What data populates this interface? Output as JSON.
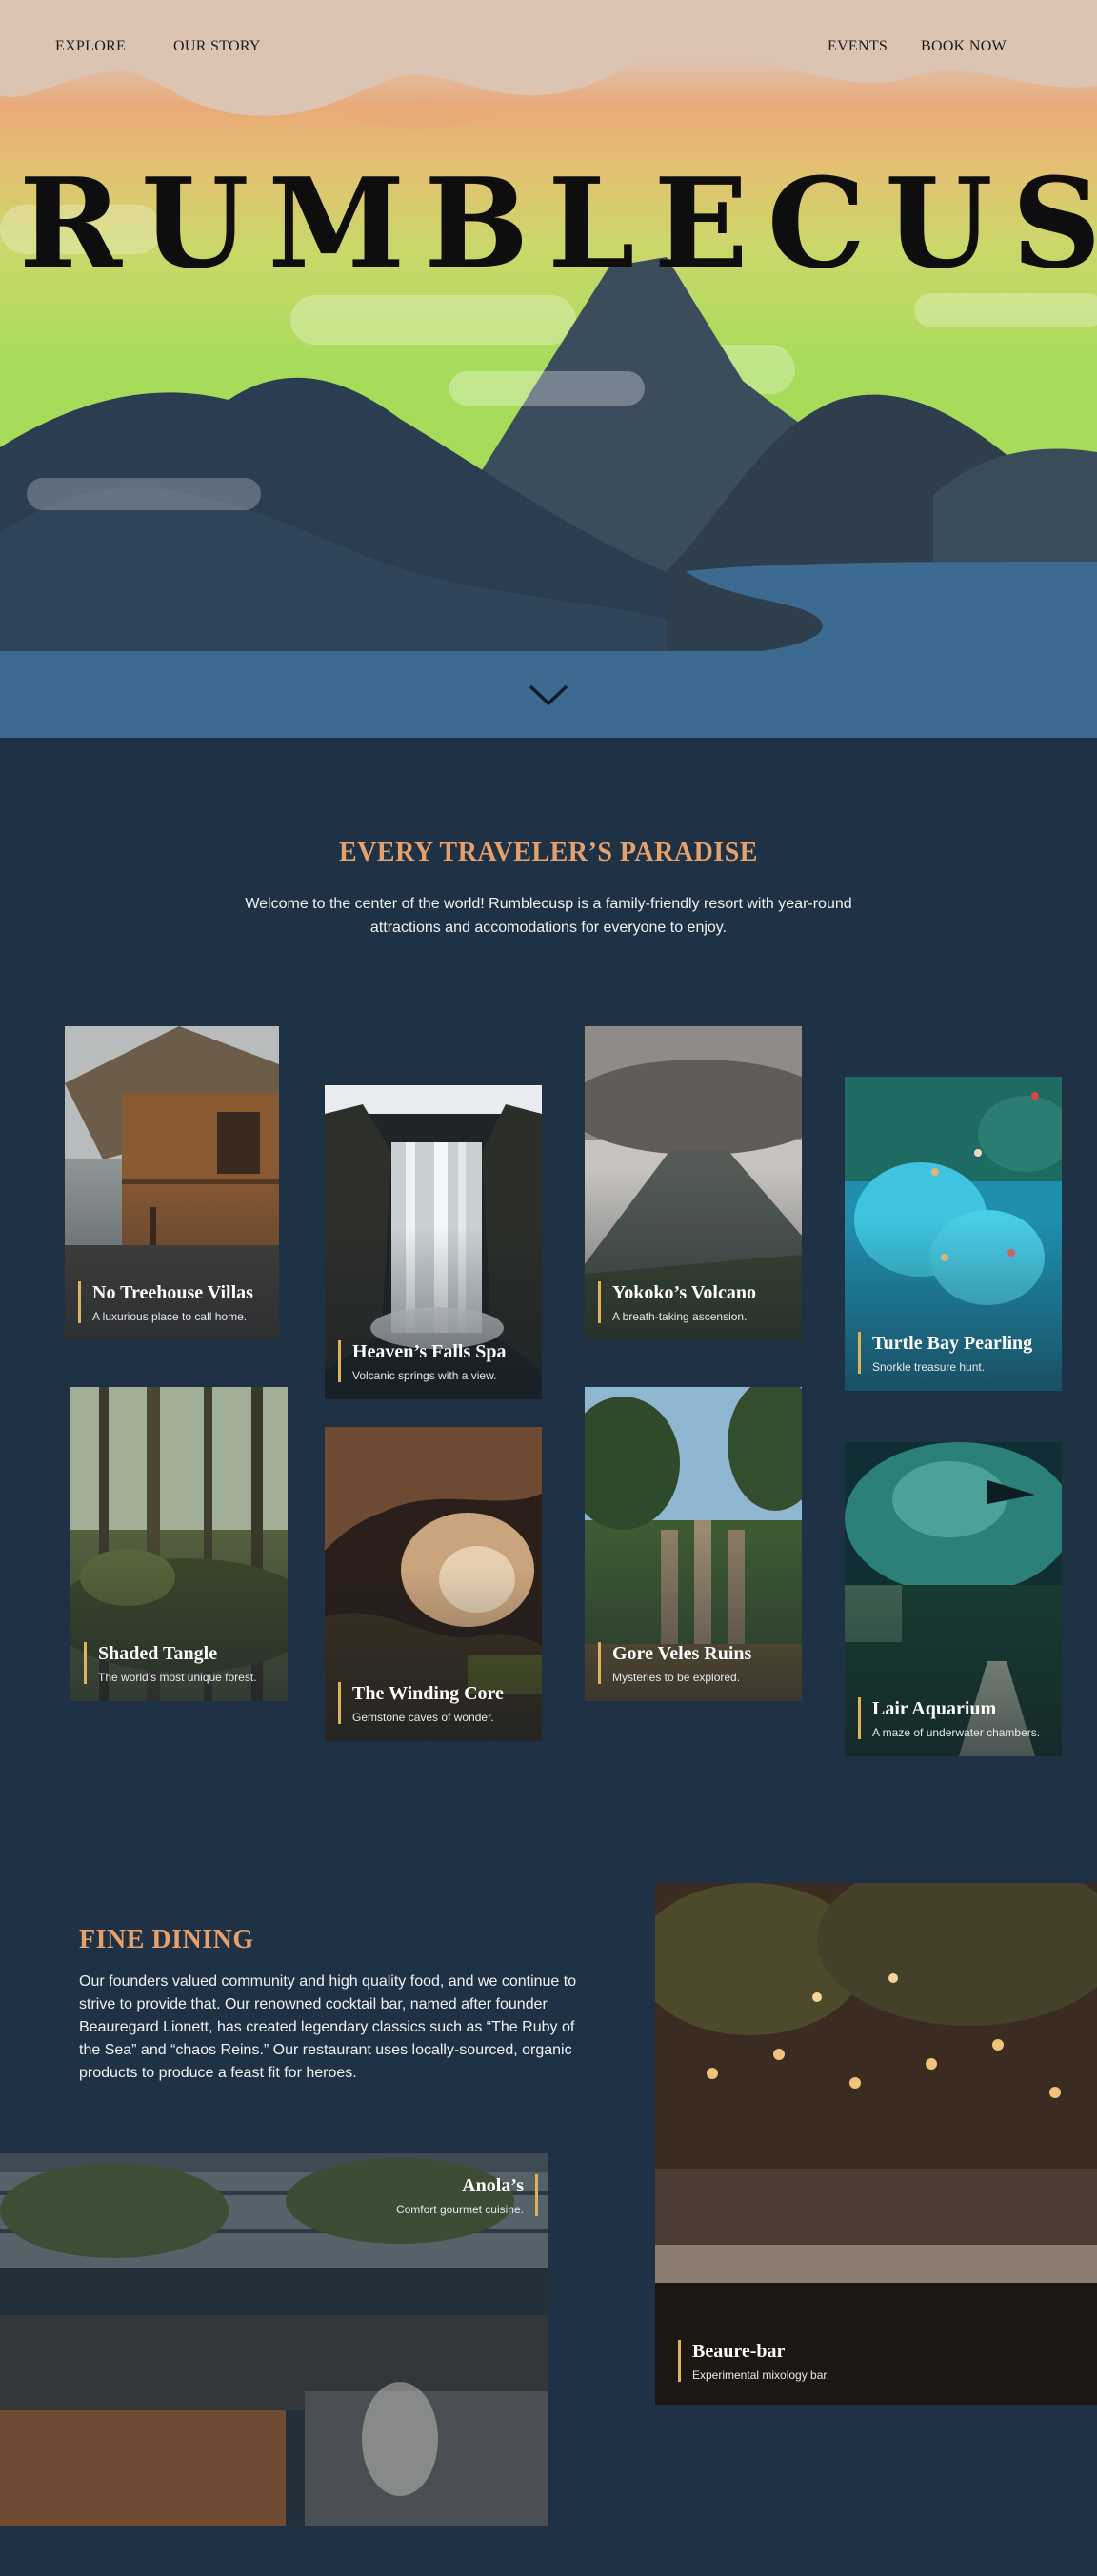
{
  "nav": {
    "left": [
      "EXPLORE",
      "OUR STORY"
    ],
    "right": [
      "EVENTS",
      "BOOK NOW"
    ]
  },
  "hero": {
    "title": "RUMBLECUSP"
  },
  "paradise": {
    "heading": "EVERY TRAVELER’S PARADISE",
    "text": "Welcome to the center of the world! Rumblecusp is a family-friendly resort with year-round attractions and accomodations for everyone to enjoy."
  },
  "attractions": [
    {
      "title": "No Treehouse Villas",
      "sub": "A luxurious place to call home."
    },
    {
      "title": "Heaven’s Falls Spa",
      "sub": "Volcanic springs with a view."
    },
    {
      "title": "Yokoko’s Volcano",
      "sub": "A breath-taking ascension."
    },
    {
      "title": "Turtle Bay Pearling",
      "sub": "Snorkle treasure hunt."
    },
    {
      "title": "Shaded Tangle",
      "sub": "The world’s most unique forest."
    },
    {
      "title": "The Winding Core",
      "sub": "Gemstone caves of wonder."
    },
    {
      "title": "Gore Veles Ruins",
      "sub": "Mysteries to be explored."
    },
    {
      "title": "Lair Aquarium",
      "sub": "A maze of underwater chambers."
    }
  ],
  "dining": {
    "heading": "FINE DINING",
    "text": "Our founders valued community and high quality food, and we continue to strive to provide that. Our renowned cocktail bar, named after founder Beauregard Lionett, has created legendary classics such as “The Ruby of the Sea” and “chaos Reins.” Our restaurant uses locally-sourced, organic products to produce a feast fit for heroes.",
    "venues": [
      {
        "title": "Anola’s",
        "sub": "Comfort gourmet cuisine."
      },
      {
        "title": "Beaure-bar",
        "sub": "Experimental mixology bar."
      }
    ]
  },
  "colors": {
    "page_bg": "#1f3245",
    "accent": "#e6a06c",
    "caption_bar": "#e0b35a",
    "water": "#3d6a90"
  },
  "icons": {
    "scroll": "chevron-down-icon"
  }
}
